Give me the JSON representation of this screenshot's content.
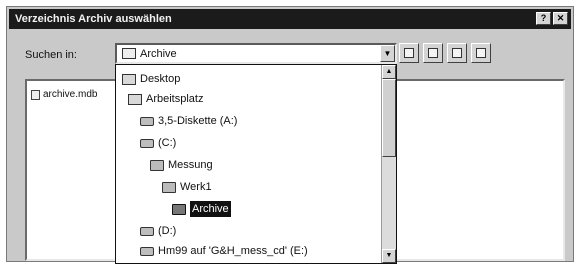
{
  "window": {
    "title": "Verzeichnis Archiv auswählen"
  },
  "lookin": {
    "label": "Suchen in:",
    "selected": "Archive"
  },
  "file_list": [
    {
      "name": "archive.mdb"
    }
  ],
  "dropdown": {
    "items": [
      {
        "label": "Desktop",
        "icon": "desktop-icon"
      },
      {
        "label": "Arbeitsplatz",
        "icon": "computer-icon"
      },
      {
        "label": "3,5-Diskette (A:)",
        "icon": "floppy-drive-icon"
      },
      {
        "label": "(C:)",
        "icon": "hard-drive-icon"
      },
      {
        "label": "Messung",
        "icon": "folder-icon"
      },
      {
        "label": "Werk1",
        "icon": "folder-icon"
      },
      {
        "label": "Archive",
        "icon": "open-folder-icon",
        "selected": true
      },
      {
        "label": "(D:)",
        "icon": "cd-drive-icon"
      },
      {
        "label": "Hm99 auf 'G&H_mess_cd' (E:)",
        "icon": "network-drive-icon"
      }
    ]
  },
  "toolbar": {
    "buttons": [
      "up-folder-icon",
      "new-folder-icon",
      "list-view-icon",
      "details-view-icon"
    ]
  }
}
